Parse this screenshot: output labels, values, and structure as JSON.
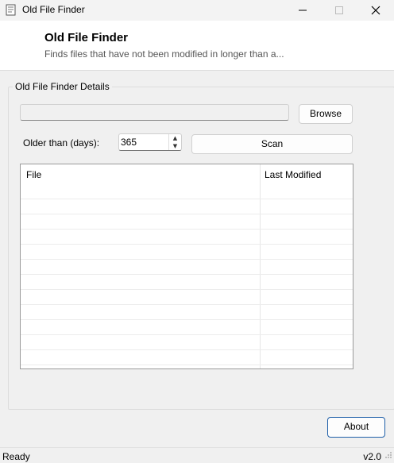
{
  "window": {
    "title": "Old File Finder"
  },
  "header": {
    "title": "Old File Finder",
    "subtitle": "Finds files that have not been modified in longer than a..."
  },
  "group": {
    "title": "Old File Finder Details",
    "path_value": "",
    "browse_label": "Browse",
    "older_label": "Older than (days):",
    "days_value": "365",
    "scan_label": "Scan"
  },
  "table": {
    "columns": [
      "File",
      "Last Modified"
    ],
    "rows": []
  },
  "footer": {
    "about_label": "About"
  },
  "status": {
    "text": "Ready",
    "version": "v2.0"
  },
  "icons": {
    "app": "document-icon",
    "minimize": "minimize-icon",
    "maximize": "maximize-icon",
    "close": "close-icon",
    "spin_up": "chevron-up-icon",
    "spin_down": "chevron-down-icon"
  },
  "colors": {
    "accent": "#1f5fa8",
    "background": "#f0f0f0",
    "header_bg": "#ffffff"
  }
}
